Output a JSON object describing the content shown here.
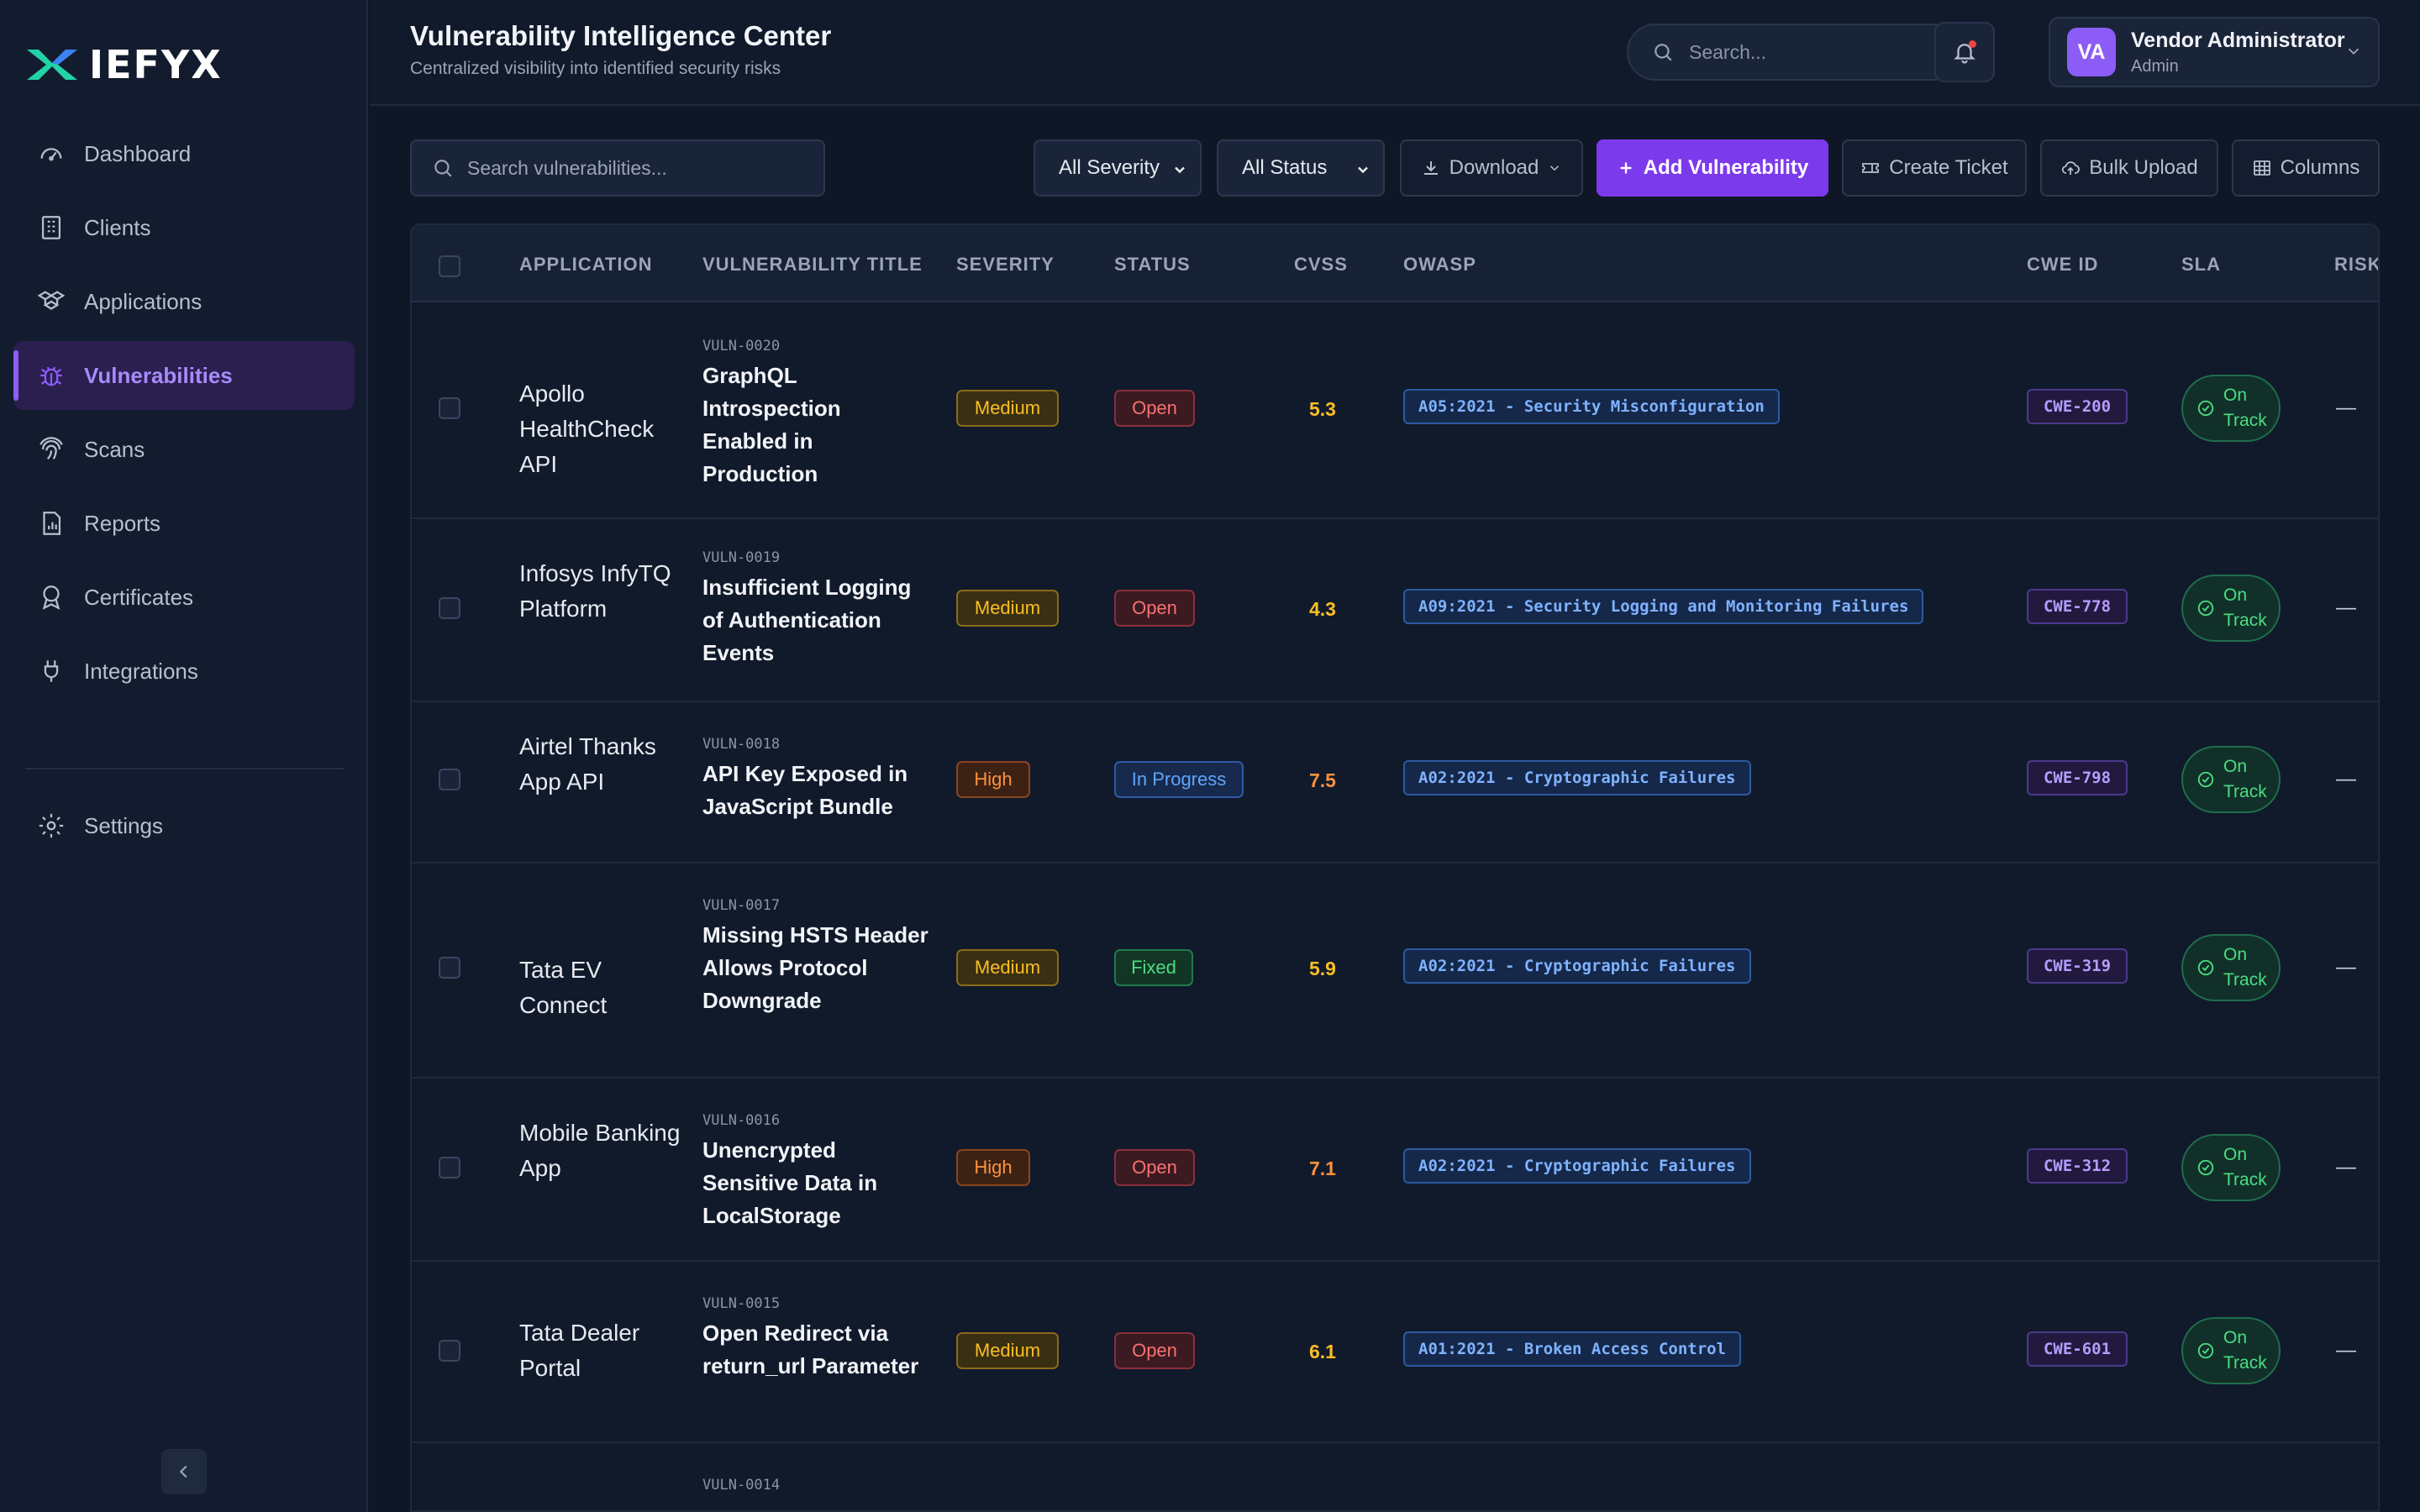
{
  "brand": {
    "name": "IEFYX"
  },
  "sidebar": {
    "items": [
      {
        "label": "Dashboard",
        "icon": "gauge-icon"
      },
      {
        "label": "Clients",
        "icon": "building-icon"
      },
      {
        "label": "Applications",
        "icon": "boxes-icon"
      },
      {
        "label": "Vulnerabilities",
        "icon": "bug-icon",
        "active": true
      },
      {
        "label": "Scans",
        "icon": "fingerprint-icon"
      },
      {
        "label": "Reports",
        "icon": "report-icon"
      },
      {
        "label": "Certificates",
        "icon": "award-icon"
      },
      {
        "label": "Integrations",
        "icon": "plug-icon"
      }
    ],
    "settings": {
      "label": "Settings",
      "icon": "gear-icon"
    }
  },
  "header": {
    "title": "Vulnerability Intelligence Center",
    "subtitle": "Centralized visibility into identified security risks",
    "search_placeholder": "Search...",
    "user": {
      "initials": "VA",
      "name": "Vendor Administrator",
      "role": "Admin"
    }
  },
  "toolbar": {
    "search_placeholder": "Search vulnerabilities...",
    "severity_filter": "All Severity",
    "status_filter": "All Status",
    "download": "Download",
    "add": "Add Vulnerability",
    "create_ticket": "Create Ticket",
    "bulk_upload": "Bulk Upload",
    "columns": "Columns"
  },
  "table": {
    "headers": {
      "application": "APPLICATION",
      "title": "VULNERABILITY TITLE",
      "severity": "SEVERITY",
      "status": "STATUS",
      "cvss": "CVSS",
      "owasp": "OWASP",
      "cwe": "CWE ID",
      "sla": "SLA",
      "risk": "RISK"
    },
    "rows": [
      {
        "app": "Apollo HealthCheck API",
        "id": "VULN-0020",
        "title": "GraphQL Introspection Enabled in Production",
        "severity": "Medium",
        "status": "Open",
        "cvss": "5.3",
        "owasp": "A05:2021 - Security Misconfiguration",
        "cwe": "CWE-200",
        "sla": "On Track",
        "risk": "—"
      },
      {
        "app": "Infosys InfyTQ Platform",
        "id": "VULN-0019",
        "title": "Insufficient Logging of Authentication Events",
        "severity": "Medium",
        "status": "Open",
        "cvss": "4.3",
        "owasp": "A09:2021 - Security Logging and Monitoring Failures",
        "cwe": "CWE-778",
        "sla": "On Track",
        "risk": "—"
      },
      {
        "app": "Airtel Thanks App API",
        "id": "VULN-0018",
        "title": "API Key Exposed in JavaScript Bundle",
        "severity": "High",
        "status": "In Progress",
        "cvss": "7.5",
        "owasp": "A02:2021 - Cryptographic Failures",
        "cwe": "CWE-798",
        "sla": "On Track",
        "risk": "—"
      },
      {
        "app": "Tata EV Connect",
        "id": "VULN-0017",
        "title": "Missing HSTS Header Allows Protocol Downgrade",
        "severity": "Medium",
        "status": "Fixed",
        "cvss": "5.9",
        "owasp": "A02:2021 - Cryptographic Failures",
        "cwe": "CWE-319",
        "sla": "On Track",
        "risk": "—"
      },
      {
        "app": "Mobile Banking App",
        "id": "VULN-0016",
        "title": "Unencrypted Sensitive Data in LocalStorage",
        "severity": "High",
        "status": "Open",
        "cvss": "7.1",
        "owasp": "A02:2021 - Cryptographic Failures",
        "cwe": "CWE-312",
        "sla": "On Track",
        "risk": "—"
      },
      {
        "app": "Tata Dealer Portal",
        "id": "VULN-0015",
        "title": "Open Redirect via return_url Parameter",
        "severity": "Medium",
        "status": "Open",
        "cvss": "6.1",
        "owasp": "A01:2021 - Broken Access Control",
        "cwe": "CWE-601",
        "sla": "On Track",
        "risk": "—"
      },
      {
        "app": "",
        "id": "VULN-0014",
        "title": "",
        "severity": "",
        "status": "",
        "cvss": "",
        "owasp": "",
        "cwe": "",
        "sla": "",
        "risk": ""
      }
    ]
  },
  "colors": {
    "accent": "#8b5cf6",
    "medium": "#fbbf24",
    "high": "#fb923c",
    "open": "#f87171",
    "progress": "#60a5fa",
    "fixed": "#4ade80"
  }
}
